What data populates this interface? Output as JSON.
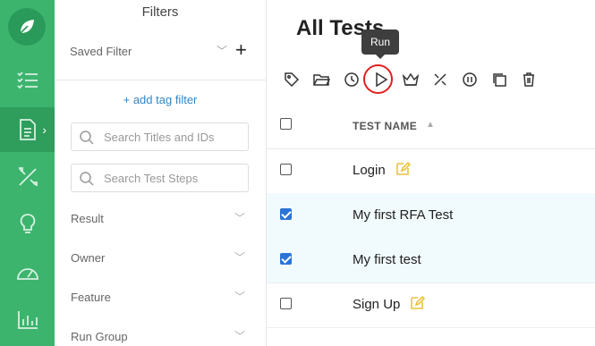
{
  "nav": {
    "items": [
      {
        "name": "logo",
        "icon": "leaf-icon"
      },
      {
        "name": "checklist",
        "icon": "checklist-icon"
      },
      {
        "name": "tests",
        "icon": "document-icon",
        "active": true
      },
      {
        "name": "tools",
        "icon": "tools-icon"
      },
      {
        "name": "ideas",
        "icon": "lightbulb-icon"
      },
      {
        "name": "dashboard",
        "icon": "gauge-icon"
      },
      {
        "name": "reports",
        "icon": "bar-chart-icon"
      }
    ],
    "accent_color": "#3cb46e"
  },
  "filters": {
    "title": "Filters",
    "saved_filter_label": "Saved Filter",
    "add_tag_filter": "+ add tag filter",
    "search_titles_placeholder": "Search Titles and IDs",
    "search_steps_placeholder": "Search Test Steps",
    "facets": [
      "Result",
      "Owner",
      "Feature",
      "Run Group"
    ]
  },
  "main": {
    "title": "All Tests",
    "tooltip": "Run",
    "toolbar_icons": [
      "tag-icon",
      "folder-icon",
      "clock-icon",
      "play-icon",
      "crown-icon",
      "tools-icon",
      "pause-icon",
      "copy-icon",
      "trash-icon"
    ],
    "column_header": "TEST NAME",
    "rows": [
      {
        "name": "Login",
        "checked": false,
        "edit_icon": true
      },
      {
        "name": "My first RFA Test",
        "checked": true,
        "edit_icon": false
      },
      {
        "name": "My first test",
        "checked": true,
        "edit_icon": false
      },
      {
        "name": "Sign Up",
        "checked": false,
        "edit_icon": true
      }
    ]
  }
}
